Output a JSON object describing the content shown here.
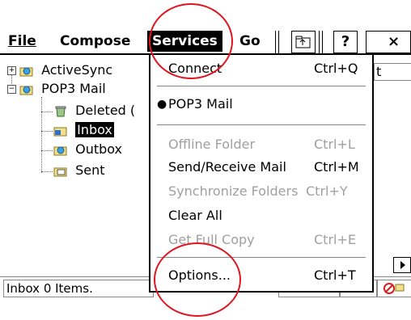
{
  "menubar": {
    "file": "File",
    "compose": "Compose",
    "services": "Services",
    "go": "Go",
    "help_btn": "?",
    "close_btn": "×"
  },
  "tree": {
    "items": [
      {
        "label": "ActiveSync"
      },
      {
        "label": "POP3 Mail"
      },
      {
        "label": "Deleted ("
      },
      {
        "label": "Inbox"
      },
      {
        "label": "Outbox"
      },
      {
        "label": "Sent"
      }
    ]
  },
  "list_header_fragment": "t",
  "status": {
    "text": "Inbox 0 Items."
  },
  "services_menu": {
    "items": [
      {
        "label": "Connect",
        "shortcut": "Ctrl+Q"
      },
      {
        "label": "POP3 Mail",
        "shortcut": ""
      },
      {
        "label": "Offline Folder",
        "shortcut": "Ctrl+L"
      },
      {
        "label": "Send/Receive Mail",
        "shortcut": "Ctrl+M"
      },
      {
        "label": "Synchronize Folders",
        "shortcut": "Ctrl+Y"
      },
      {
        "label": "Clear All",
        "shortcut": ""
      },
      {
        "label": "Get Full Copy",
        "shortcut": "Ctrl+E"
      },
      {
        "label": "Options...",
        "shortcut": "Ctrl+T"
      }
    ]
  },
  "colors": {
    "annotation": "#e0141e",
    "disabled": "#a0a0a0"
  }
}
